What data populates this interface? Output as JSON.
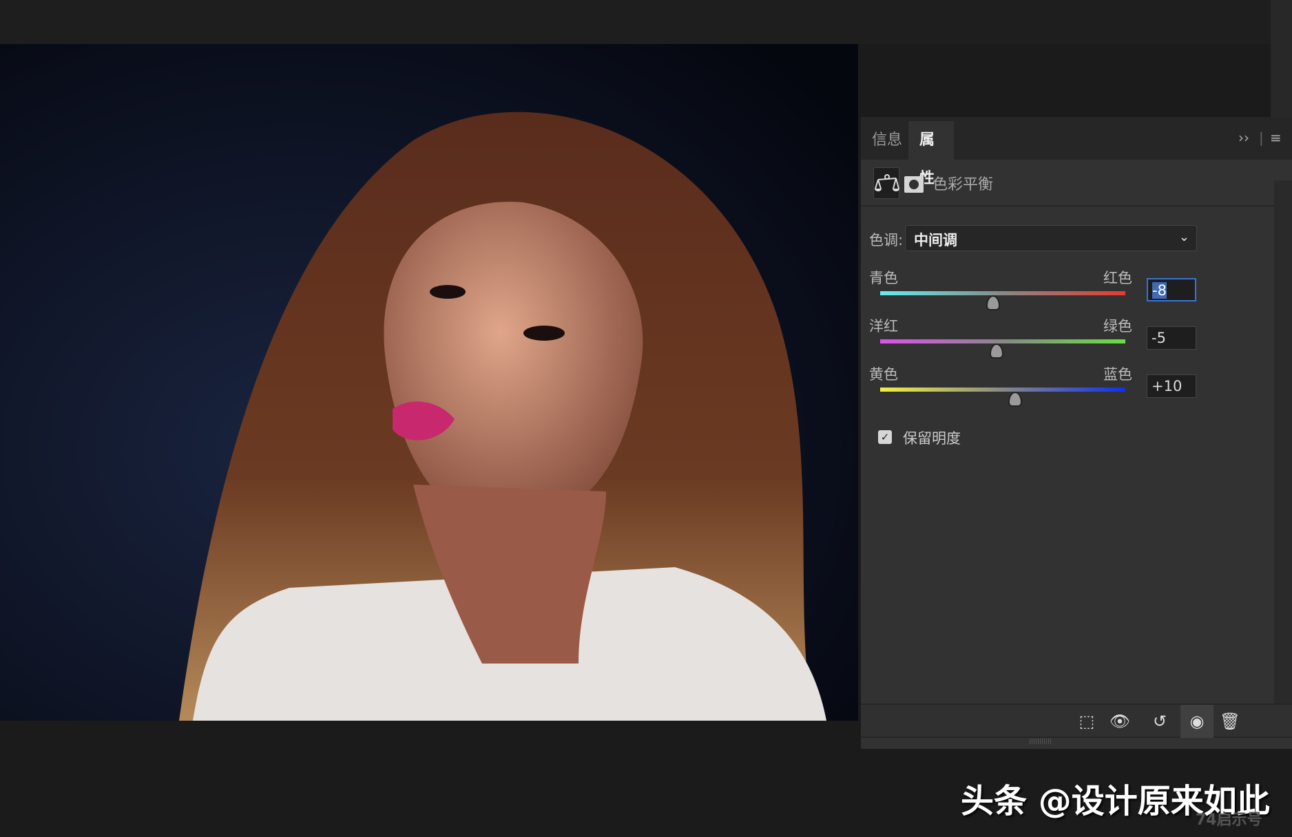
{
  "panel": {
    "tabs": [
      {
        "label": "信息"
      },
      {
        "label": "属性"
      }
    ],
    "collapse_icon": "double-chevron-right",
    "menu_icon": "hamburger",
    "adjustment_title": "色彩平衡",
    "tone_label": "色调:",
    "tone_value": "中间调",
    "sliders": [
      {
        "left": "青色",
        "right": "红色",
        "value": "-8",
        "num": -8,
        "colors": [
          "#5ff0f0",
          "#e83a2e"
        ]
      },
      {
        "left": "洋红",
        "right": "绿色",
        "value": "-5",
        "num": -5,
        "colors": [
          "#e050f0",
          "#66e040"
        ]
      },
      {
        "left": "黄色",
        "right": "蓝色",
        "value": "+10",
        "num": 10,
        "colors": [
          "#f2f040",
          "#1030f0"
        ]
      }
    ],
    "slider_range": [
      -100,
      100
    ],
    "preserve_luminosity": {
      "label": "保留明度",
      "checked": true
    },
    "toolbar": [
      "clip-to-layer",
      "view-previous-state",
      "reset",
      "toggle-visibility",
      "delete"
    ]
  },
  "watermark": {
    "text": "头条 @设计原来如此",
    "sub": "74启示号"
  }
}
